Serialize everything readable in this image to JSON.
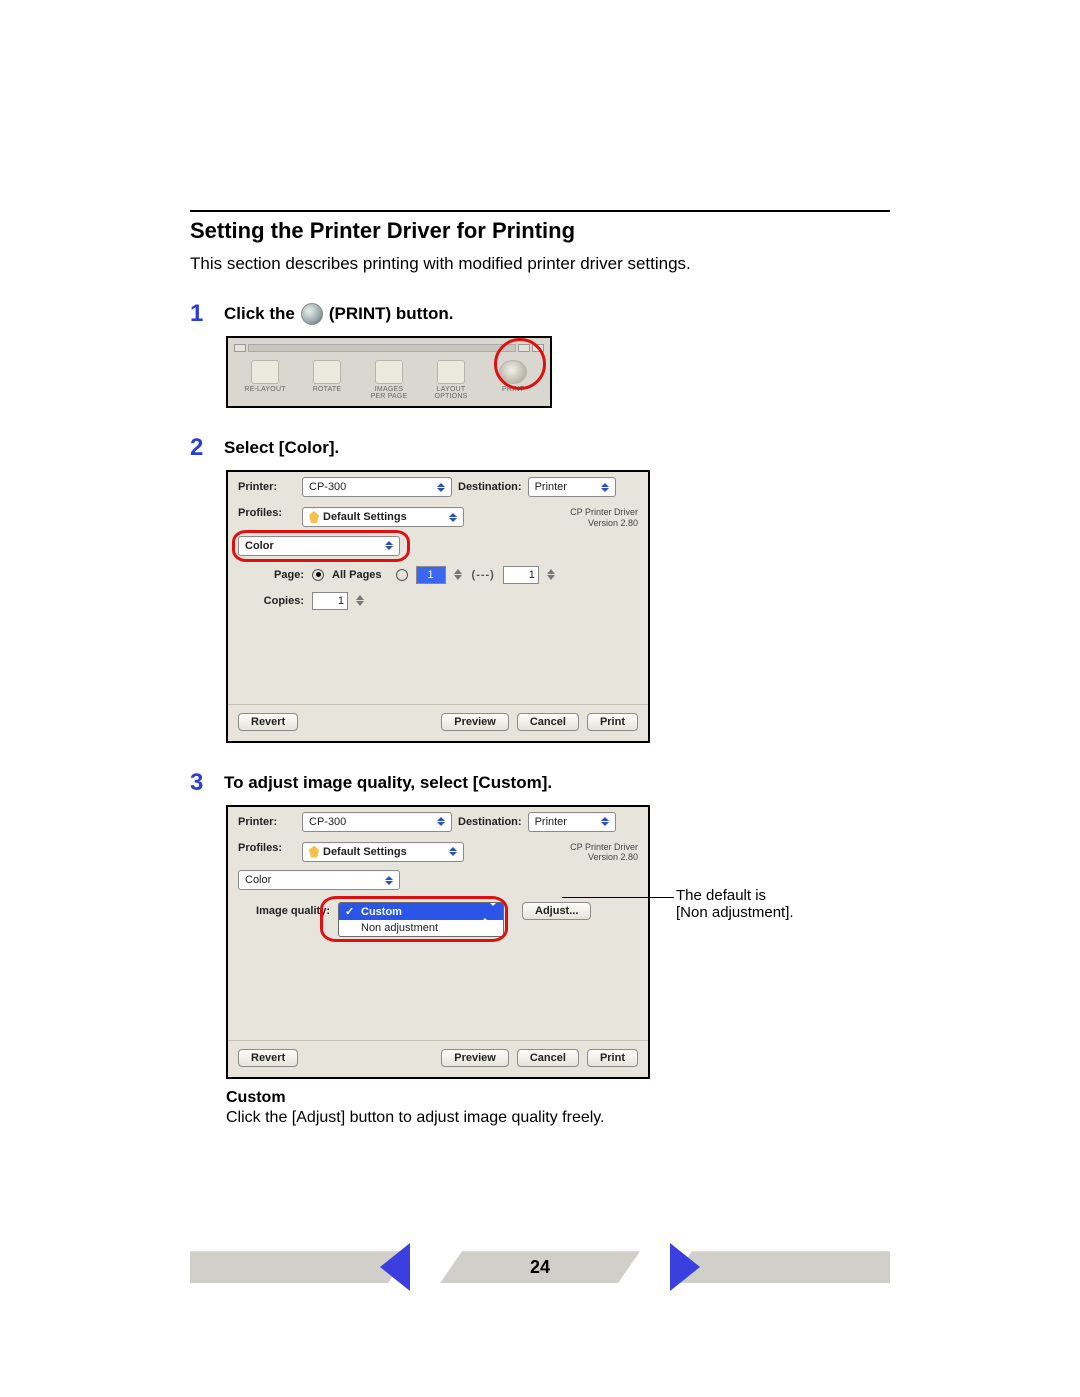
{
  "heading": "Setting the Printer Driver for Printing",
  "intro": "This section describes printing with modified printer driver settings.",
  "step1": {
    "num": "1",
    "pre": "Click the",
    "post": "(PRINT) button.",
    "toolbar": {
      "relayout": "RE-LAYOUT",
      "rotate": "ROTATE",
      "images": "IMAGES",
      "perpage": "PER PAGE",
      "layout": "LAYOUT",
      "options": "OPTIONS",
      "print": "PRINT"
    }
  },
  "step2": {
    "num": "2",
    "text": "Select [Color].",
    "dialog": {
      "printer_label": "Printer:",
      "printer_value": "CP-300",
      "dest_label": "Destination:",
      "dest_value": "Printer",
      "profiles_label": "Profiles:",
      "profiles_value": "Default Settings",
      "driver_name": "CP Printer Driver",
      "driver_version": "Version 2.80",
      "tab_value": "Color",
      "page_label": "Page:",
      "allpages": "All Pages",
      "from_val": "1",
      "dashes": "(---)",
      "to_val": "1",
      "copies_label": "Copies:",
      "copies_val": "1",
      "revert": "Revert",
      "preview": "Preview",
      "cancel": "Cancel",
      "print": "Print"
    }
  },
  "step3": {
    "num": "3",
    "text": "To adjust image quality, select [Custom].",
    "dialog": {
      "printer_label": "Printer:",
      "printer_value": "CP-300",
      "dest_label": "Destination:",
      "dest_value": "Printer",
      "profiles_label": "Profiles:",
      "profiles_value": "Default Settings",
      "driver_name": "CP Printer Driver",
      "driver_version": "Version 2.80",
      "tab_value": "Color",
      "iq_label": "Image quality:",
      "opt_custom": "Custom",
      "opt_nonadj": "Non adjustment",
      "adjust": "Adjust...",
      "revert": "Revert",
      "preview": "Preview",
      "cancel": "Cancel",
      "print": "Print"
    },
    "callout_l1": "The default is",
    "callout_l2": "[Non adjustment].",
    "custom_heading": "Custom",
    "custom_text": "Click the [Adjust] button to adjust image quality freely."
  },
  "page_number": "24"
}
